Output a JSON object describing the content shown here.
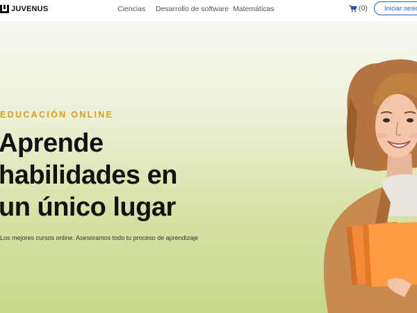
{
  "header": {
    "logo_text": "JUVENUS",
    "nav": [
      "Ciencias",
      "Desarrollo de software",
      "Matemáticas"
    ],
    "cart_count": "(0)",
    "login_label": "Iniciar sesión"
  },
  "hero": {
    "eyebrow": "EDUCACIÓN ONLINE",
    "headline": [
      "Aprende",
      "habilidades en",
      "un único lugar"
    ],
    "subtitle": "Los mejores cursos online. Asesoramos todo tu proceso de aprendizaje"
  },
  "icons": {
    "cart": "cart-icon",
    "logo": "logo-mark-icon"
  },
  "colors": {
    "accent": "#2a64d6",
    "eyebrow": "#d7a017",
    "hero_bg_top": "#f7f8f2",
    "hero_bg_bottom": "#c6d88a"
  }
}
